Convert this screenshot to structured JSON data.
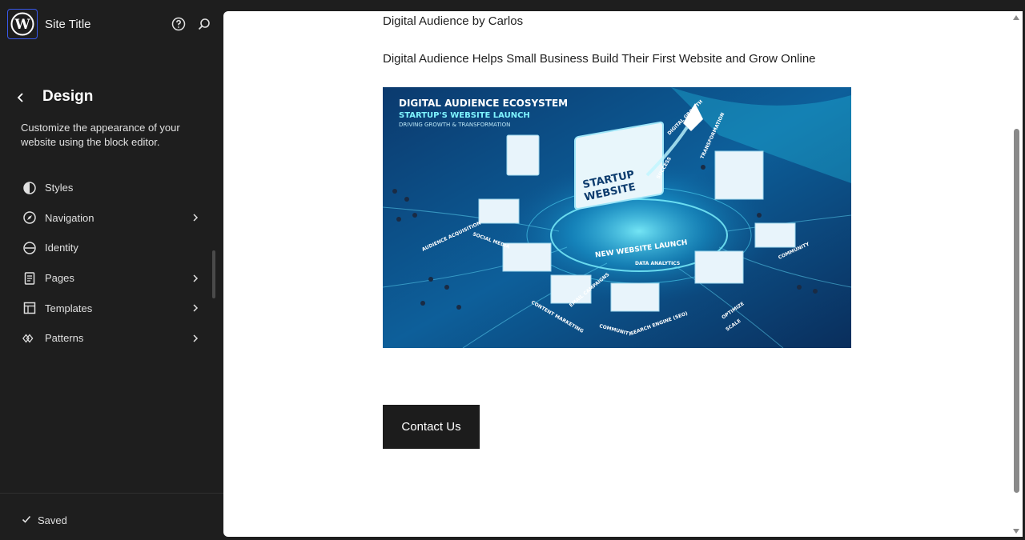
{
  "header": {
    "site_title": "Site Title",
    "logo_icon": "wordpress-logo-icon",
    "help_icon": "help-icon",
    "search_icon": "search-icon"
  },
  "panel": {
    "title": "Design",
    "description": "Customize the appearance of your website using the block editor.",
    "items": [
      {
        "label": "Styles",
        "icon": "styles-icon",
        "has_chevron": false
      },
      {
        "label": "Navigation",
        "icon": "navigation-icon",
        "has_chevron": true
      },
      {
        "label": "Identity",
        "icon": "identity-icon",
        "has_chevron": false
      },
      {
        "label": "Pages",
        "icon": "pages-icon",
        "has_chevron": true
      },
      {
        "label": "Templates",
        "icon": "templates-icon",
        "has_chevron": true
      },
      {
        "label": "Patterns",
        "icon": "patterns-icon",
        "has_chevron": true
      }
    ]
  },
  "footer": {
    "status": "Saved"
  },
  "canvas": {
    "byline": "Digital Audience by Carlos",
    "tagline": "Digital Audience Helps Small Business Build Their First Website and Grow Online",
    "hero_image": {
      "title": "DIGITAL AUDIENCE ECOSYSTEM",
      "subtitle": "STARTUP'S WEBSITE LAUNCH",
      "caption": "DRIVING GROWTH & TRANSFORMATION",
      "screen_text_1": "STARTUP",
      "screen_text_2": "WEBSITE",
      "ring_text": "NEW WEBSITE LAUNCH",
      "labels": [
        "AUDIENCE ACQUISITION",
        "SOCIAL MEDIA",
        "CONTENT MARKETING",
        "EMAIL CAMPAIGNS",
        "COMMUNITY",
        "SEARCH ENGINE (SEO)",
        "DATA ANALYTICS",
        "OPTIMIZE",
        "SCALE",
        "DIGITAL GROWTH",
        "TRANSFORMATION",
        "SUCCESS",
        "COMMUNITY"
      ]
    },
    "cta_label": "Contact Us"
  },
  "colors": {
    "sidebar_bg": "#1e1e1e",
    "accent": "#3858e9",
    "button_bg": "#1c1c1c"
  }
}
